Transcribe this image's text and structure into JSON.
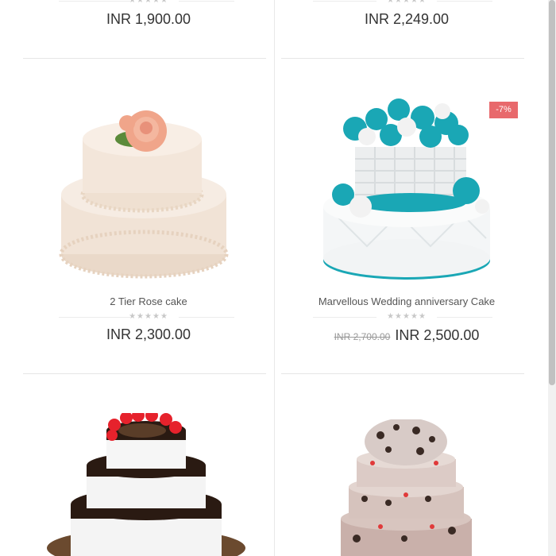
{
  "products": [
    {
      "name": "",
      "price": "INR 1,900.00",
      "old_price": "",
      "rating_stars": "★★★★★"
    },
    {
      "name": "",
      "price": "INR 2,249.00",
      "old_price": "",
      "rating_stars": "★★★★★"
    },
    {
      "name": "2 Tier Rose cake",
      "price": "INR 2,300.00",
      "old_price": "",
      "rating_stars": "★★★★★"
    },
    {
      "name": "Marvellous Wedding anniversary Cake",
      "price": "INR 2,500.00",
      "old_price": "INR 2,700.00",
      "rating_stars": "★★★★★",
      "badge": "-7%"
    },
    {
      "name": "",
      "price": "",
      "rating_stars": ""
    },
    {
      "name": "",
      "price": "",
      "rating_stars": ""
    }
  ],
  "colors": {
    "badge": "#e8696c",
    "divider": "#e6e6e6",
    "stars": "#c8c8c8",
    "teal": "#1aa7b5"
  }
}
